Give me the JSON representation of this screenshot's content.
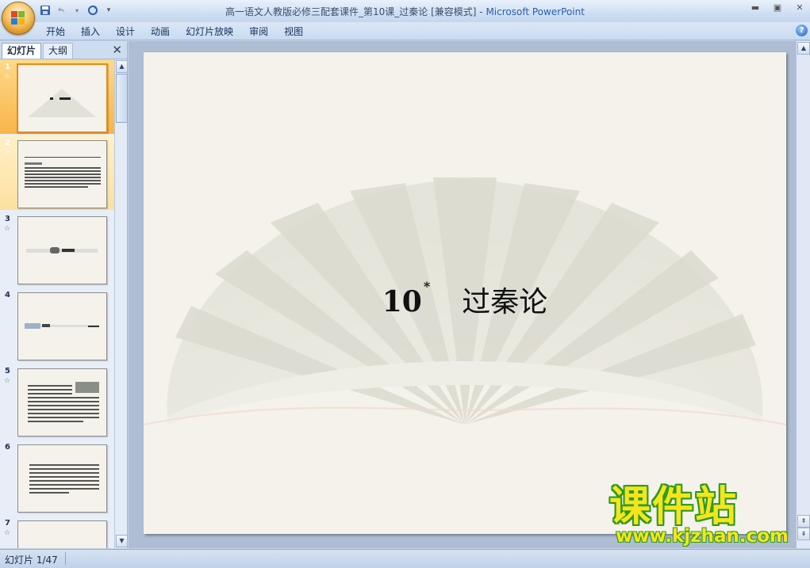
{
  "window": {
    "title": "高一语文人教版必修三配套课件_第10课_过秦论 [兼容模式]",
    "title_sep": " - ",
    "app_name": "Microsoft PowerPoint"
  },
  "ribbon": {
    "tabs": [
      "开始",
      "插入",
      "设计",
      "动画",
      "幻灯片放映",
      "审阅",
      "视图"
    ]
  },
  "left_pane": {
    "tab_slides": "幻灯片",
    "tab_outline": "大纲",
    "thumbnails": [
      {
        "num": "1",
        "star": "☆"
      },
      {
        "num": "2",
        "star": "☆"
      },
      {
        "num": "3",
        "star": "☆"
      },
      {
        "num": "4",
        "star": ""
      },
      {
        "num": "5",
        "star": "☆"
      },
      {
        "num": "6",
        "star": ""
      },
      {
        "num": "7",
        "star": "☆"
      }
    ]
  },
  "slide": {
    "number": "10",
    "mark": "*",
    "title": "过秦论"
  },
  "status": {
    "slide_counter": "幻灯片 1/47"
  },
  "watermark": {
    "text": "课件站",
    "url": "www.kjzhan.com"
  },
  "colors": {
    "slide_bg": "#f4f2ea",
    "selected_thumb": "#f7b54a",
    "watermark_fill": "#f5e51d",
    "watermark_stroke": "#2c9a1f",
    "app_name": "#2a5fb0"
  }
}
